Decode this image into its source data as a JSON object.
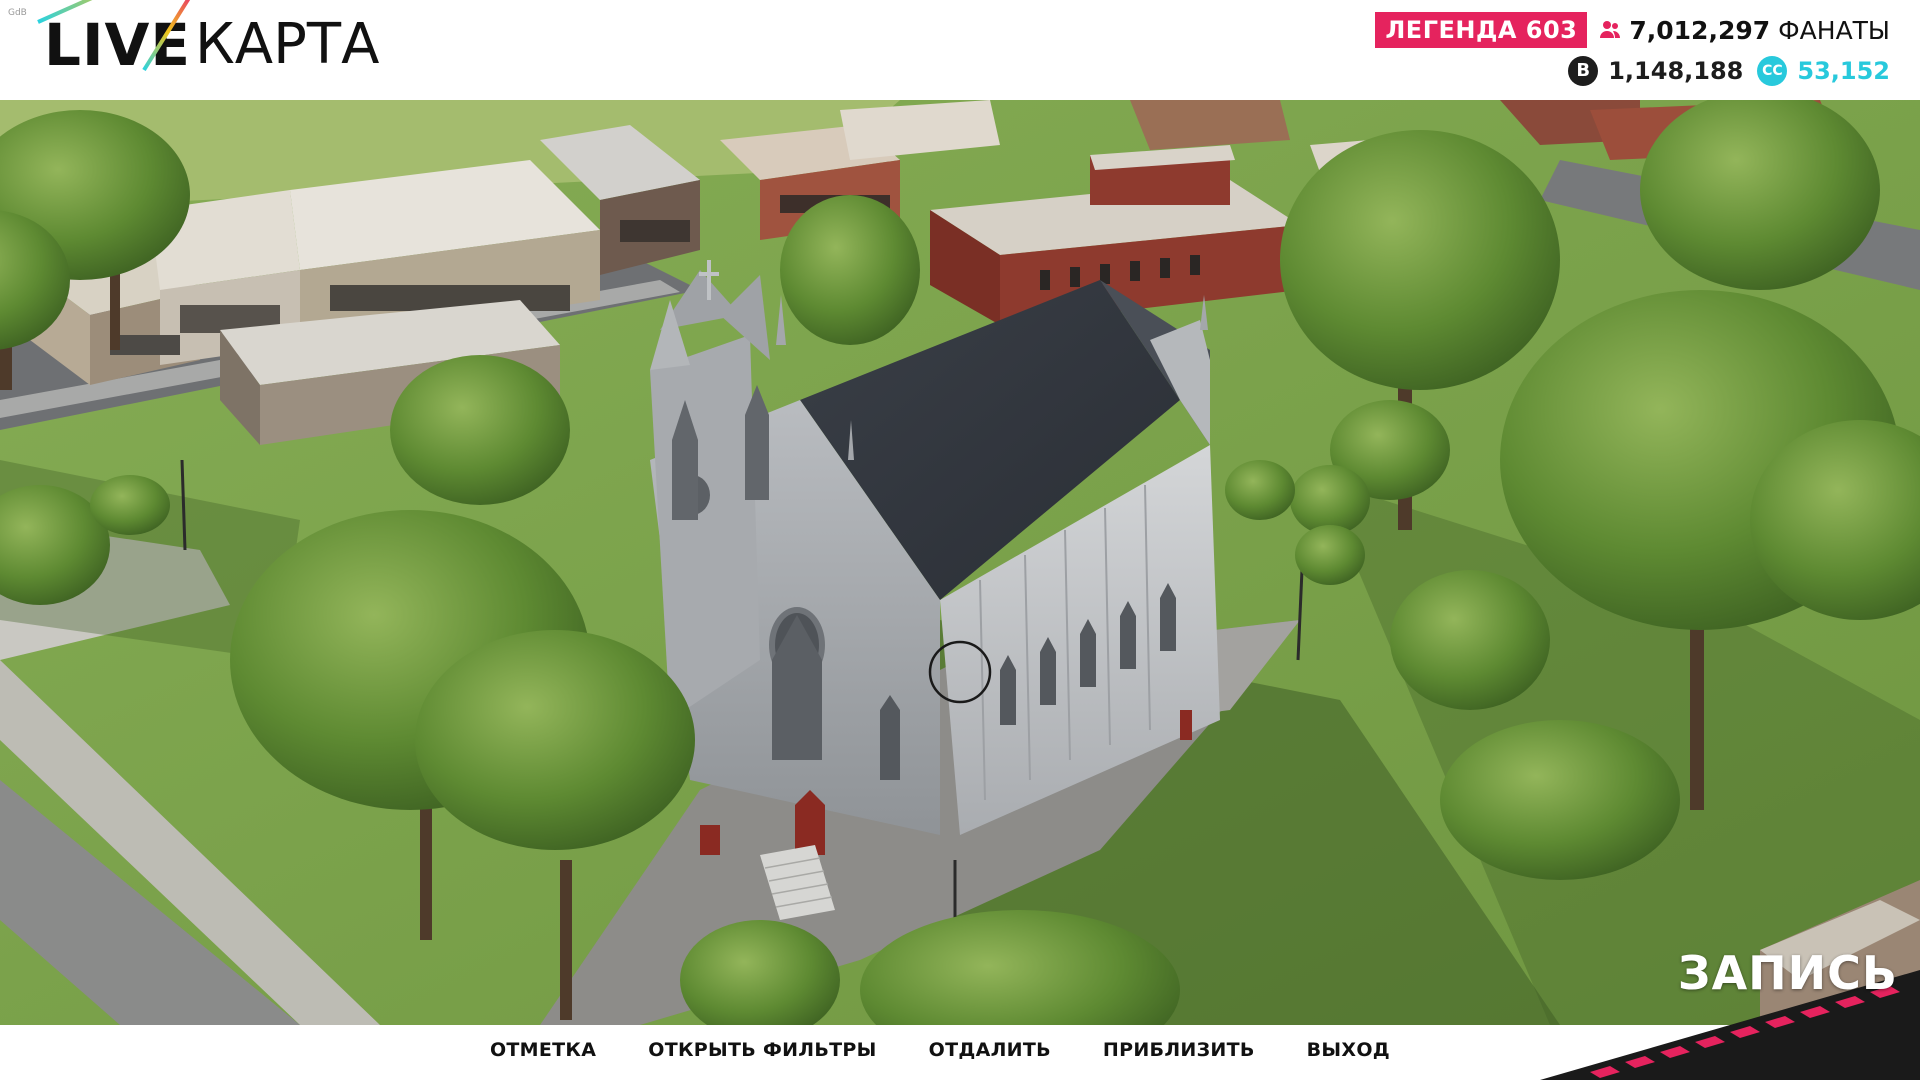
{
  "corner_tag": "GdB",
  "logo": {
    "live": "LIVE",
    "map": "КАРТА"
  },
  "stats": {
    "rank": "ЛЕГЕНДА 603",
    "fans_value": "7,012,297",
    "fans_label": "ФАНАТЫ",
    "fans_icon": "people-icon",
    "coins_value": "1,148,188",
    "coins_icon": "b-coin-icon",
    "credits_value": "53,152",
    "credits_icon": "cc-coin-icon",
    "credits_glyph": "CC",
    "coins_glyph": "B"
  },
  "actions": [
    "ОТМЕТКА",
    "ОТКРЫТЬ ФИЛЬТРЫ",
    "ОТДАЛИТЬ",
    "ПРИБЛИЗИТЬ",
    "ВЫХОД"
  ],
  "record": {
    "label": "ЗАПИСЬ"
  },
  "colors": {
    "rank_badge": "#e5235e",
    "credits": "#28c9dc",
    "grass": "#7aa24a",
    "stripe": "#e5235e"
  }
}
